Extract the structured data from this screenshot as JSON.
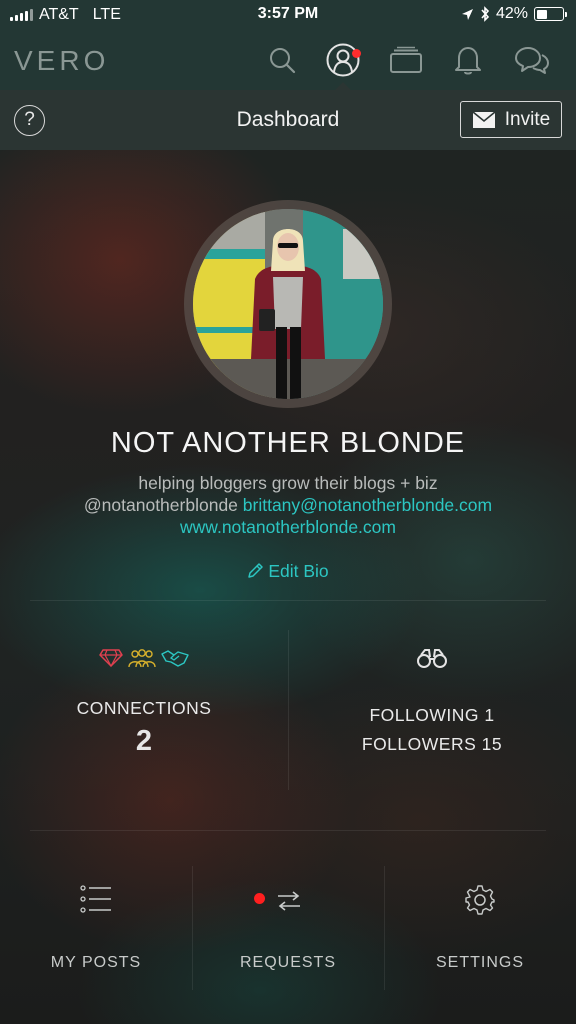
{
  "status_bar": {
    "carrier": "AT&T",
    "network": "LTE",
    "time": "3:57 PM",
    "battery_percent": "42%",
    "battery_level": 0.42
  },
  "app": {
    "logo": "VERO",
    "nav_icons": [
      "search-icon",
      "profile-icon",
      "collections-icon",
      "bell-icon",
      "chat-icon"
    ],
    "accent_color": "#2cc6c2",
    "notification_color": "#ff2d2d"
  },
  "dashboard": {
    "help_label": "?",
    "title": "Dashboard",
    "invite_label": "Invite"
  },
  "profile": {
    "name": "NOT ANOTHER BLONDE",
    "bio": "helping bloggers grow their blogs + biz",
    "handle": "@notanotherblonde",
    "email": "brittany@notanotherblonde.com",
    "website": "www.notanotherblonde.com",
    "edit_bio_label": "Edit Bio"
  },
  "stats": {
    "connections_label": "CONNECTIONS",
    "connections_count": "2",
    "connection_icons": [
      "diamond-icon",
      "group-icon",
      "handshake-icon"
    ],
    "following_label": "FOLLOWING",
    "following_count": "1",
    "followers_label": "FOLLOWERS",
    "followers_count": "15",
    "follow_icon": "binoculars-icon"
  },
  "bottom_menu": {
    "my_posts": "MY POSTS",
    "requests": "REQUESTS",
    "settings": "SETTINGS"
  }
}
